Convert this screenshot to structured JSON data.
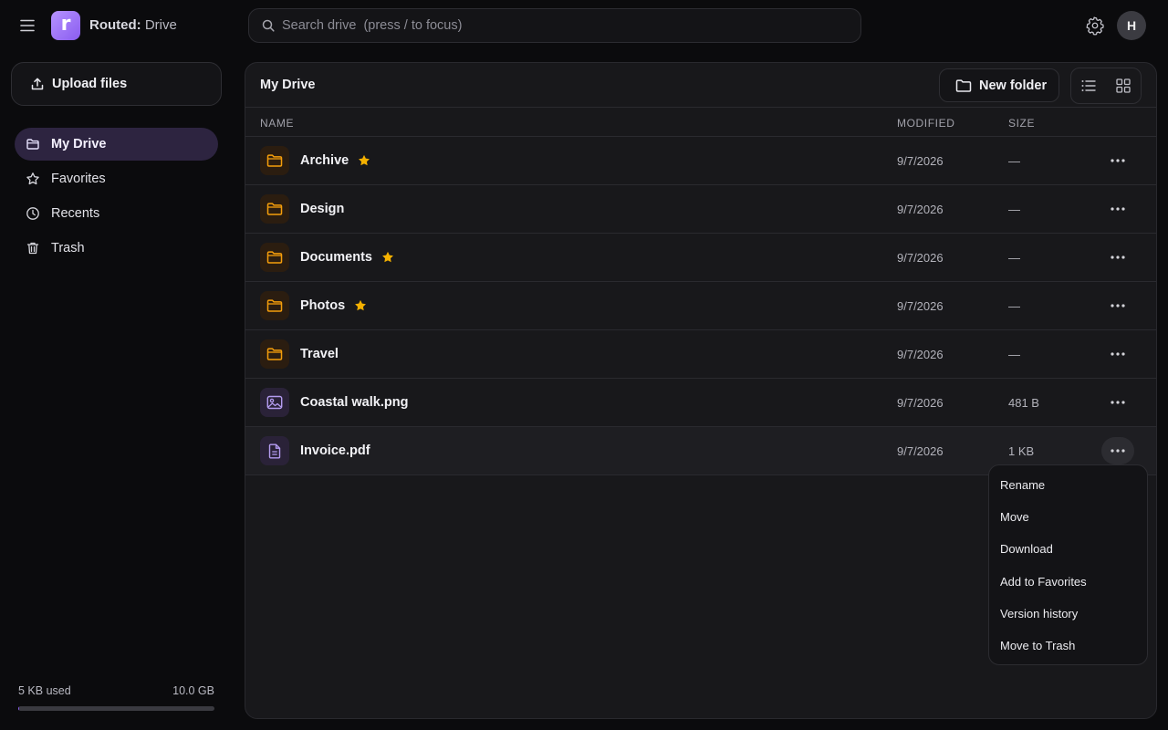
{
  "app": {
    "brand_bold": "Routed:",
    "brand_rest": " Drive",
    "logo_letter": "r",
    "accent": "#8a5cf0"
  },
  "search": {
    "placeholder": "Search drive  (press / to focus)"
  },
  "user": {
    "initial": "H"
  },
  "sidebar": {
    "upload_label": "Upload files",
    "items": [
      {
        "label": "My Drive",
        "icon": "folder-icon",
        "active": true
      },
      {
        "label": "Favorites",
        "icon": "star-icon",
        "active": false
      },
      {
        "label": "Recents",
        "icon": "clock-icon",
        "active": false
      },
      {
        "label": "Trash",
        "icon": "trash-icon",
        "active": false
      }
    ],
    "storage": {
      "used": "5 KB used",
      "total": "10.0 GB",
      "fraction_used": 0.0005
    }
  },
  "main": {
    "title": "My Drive",
    "new_folder_label": "New folder",
    "columns": {
      "name": "NAME",
      "modified": "MODIFIED",
      "size": "SIZE"
    },
    "rows": [
      {
        "name": "Archive",
        "type": "folder",
        "starred": true,
        "modified": "9/7/2026",
        "size": "—"
      },
      {
        "name": "Design",
        "type": "folder",
        "starred": false,
        "modified": "9/7/2026",
        "size": "—"
      },
      {
        "name": "Documents",
        "type": "folder",
        "starred": true,
        "modified": "9/7/2026",
        "size": "—"
      },
      {
        "name": "Photos",
        "type": "folder",
        "starred": true,
        "modified": "9/7/2026",
        "size": "—"
      },
      {
        "name": "Travel",
        "type": "folder",
        "starred": false,
        "modified": "9/7/2026",
        "size": "—"
      },
      {
        "name": "Coastal walk.png",
        "type": "image",
        "starred": false,
        "modified": "9/7/2026",
        "size": "481 B"
      },
      {
        "name": "Invoice.pdf",
        "type": "pdf",
        "starred": false,
        "modified": "9/7/2026",
        "size": "1 KB"
      }
    ]
  },
  "context_menu": {
    "items": [
      "Rename",
      "Move",
      "Download",
      "Add to Favorites",
      "Version history",
      "Move to Trash"
    ]
  },
  "colors": {
    "star": "#f5b100",
    "folder_icon": "#f59e0b",
    "file_icon": "#b49cf0"
  }
}
